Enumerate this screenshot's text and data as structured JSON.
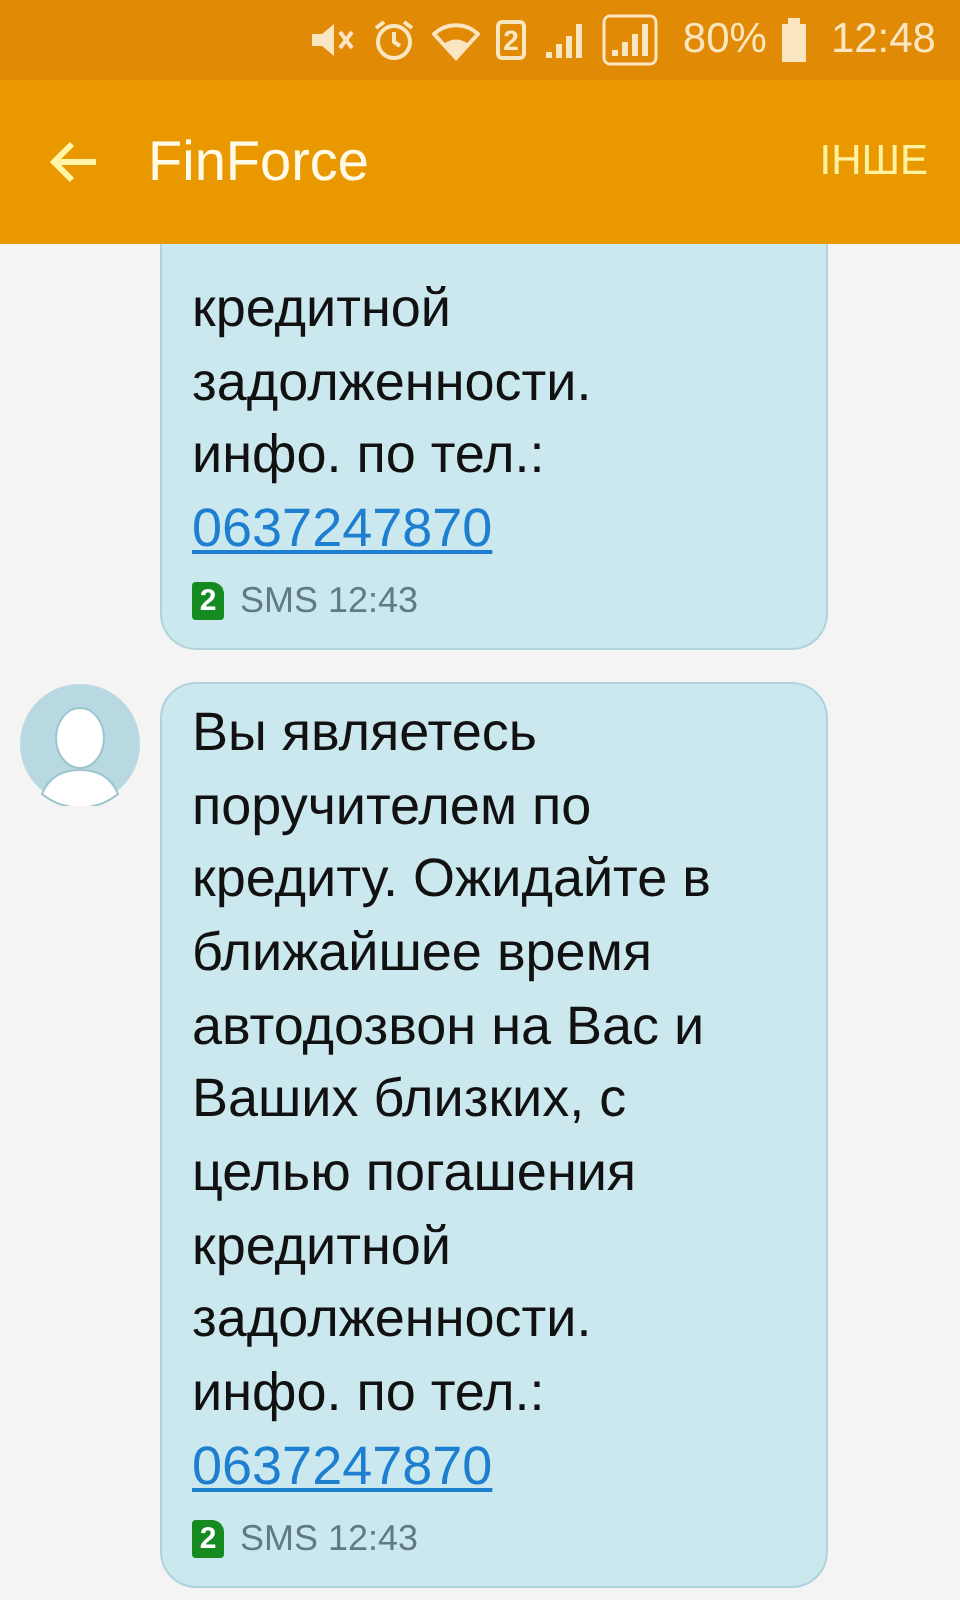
{
  "status_bar": {
    "sim": "2",
    "battery": "80%",
    "time": "12:48"
  },
  "app_bar": {
    "title": "FinForce",
    "action": "ІНШЕ"
  },
  "messages": [
    {
      "show_avatar": false,
      "text": "кредитной задолженности. инфо. по тел.:",
      "phone": "0637247870",
      "sim": "2",
      "meta": "SMS 12:43"
    },
    {
      "show_avatar": true,
      "text": "Вы являетесь поручителем по кредиту. Ожидайте в ближайшее время автодозвон на Вас и Ваших близких, с целью погашения кредитной задолженности. инфо. по тел.:",
      "phone": "0637247870",
      "sim": "2",
      "meta": "SMS 12:43"
    }
  ]
}
